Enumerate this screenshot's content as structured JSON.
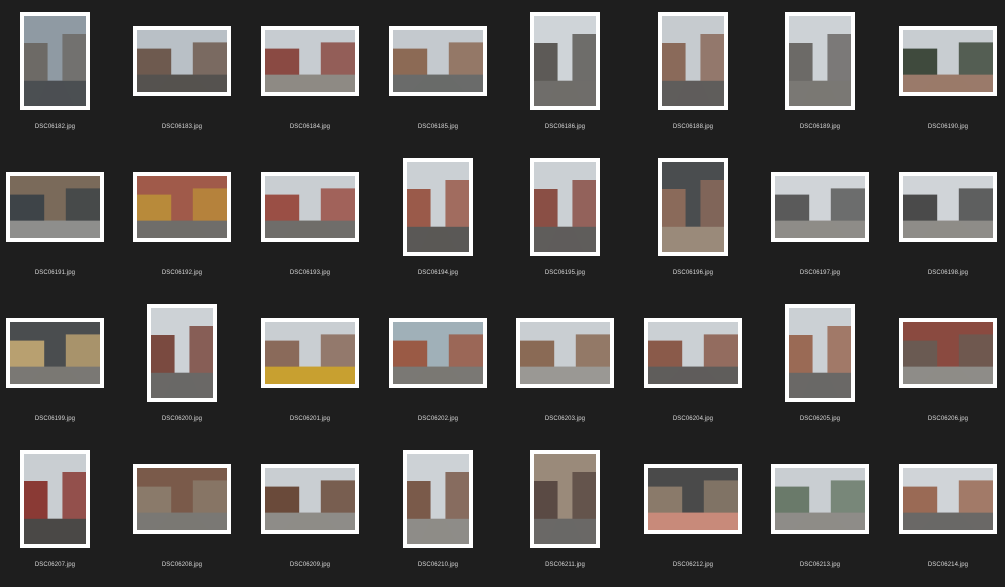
{
  "files": [
    {
      "name": "DSC06182.jpg",
      "orientation": "portrait",
      "colors": [
        "#8f9aa3",
        "#6d6a66",
        "#4b4f52"
      ]
    },
    {
      "name": "DSC06183.jpg",
      "orientation": "landscape",
      "colors": [
        "#b9c0c6",
        "#6e5a4f",
        "#55524f"
      ]
    },
    {
      "name": "DSC06184.jpg",
      "orientation": "landscape",
      "colors": [
        "#c7ccd1",
        "#8a4a43",
        "#8e8a84"
      ]
    },
    {
      "name": "DSC06185.jpg",
      "orientation": "landscape",
      "colors": [
        "#c4c9ce",
        "#8c6a55",
        "#6a6b6a"
      ]
    },
    {
      "name": "DSC06186.jpg",
      "orientation": "portrait",
      "colors": [
        "#cfd4d8",
        "#5d5a57",
        "#6f6d6a"
      ]
    },
    {
      "name": "DSC06188.jpg",
      "orientation": "portrait",
      "colors": [
        "#c6cbcf",
        "#8a6a5a",
        "#5f5d5b"
      ]
    },
    {
      "name": "DSC06189.jpg",
      "orientation": "portrait",
      "colors": [
        "#cdd2d6",
        "#6c6a67",
        "#7a7874"
      ]
    },
    {
      "name": "DSC06190.jpg",
      "orientation": "landscape",
      "colors": [
        "#c8cdd1",
        "#3f4a3d",
        "#9a7a6a"
      ]
    },
    {
      "name": "DSC06191.jpg",
      "orientation": "landscape",
      "colors": [
        "#7a6a5a",
        "#3e4448",
        "#8e8e8c"
      ]
    },
    {
      "name": "DSC06192.jpg",
      "orientation": "landscape",
      "colors": [
        "#a05a4a",
        "#b88a3a",
        "#6f6d6a"
      ]
    },
    {
      "name": "DSC06193.jpg",
      "orientation": "landscape",
      "colors": [
        "#c9ced2",
        "#9a4f45",
        "#6f6d6a"
      ]
    },
    {
      "name": "DSC06194.jpg",
      "orientation": "portrait",
      "colors": [
        "#cbd0d4",
        "#9a5a4a",
        "#5a5856"
      ]
    },
    {
      "name": "DSC06195.jpg",
      "orientation": "portrait",
      "colors": [
        "#cbd0d4",
        "#8a4f45",
        "#5f5d5b"
      ]
    },
    {
      "name": "DSC06196.jpg",
      "orientation": "portrait",
      "colors": [
        "#4a4d4f",
        "#8a6a5a",
        "#9a8a7a"
      ]
    },
    {
      "name": "DSC06197.jpg",
      "orientation": "landscape",
      "colors": [
        "#d0d4d8",
        "#5a5a5a",
        "#8e8c88"
      ]
    },
    {
      "name": "DSC06198.jpg",
      "orientation": "landscape",
      "colors": [
        "#d0d4d8",
        "#4a4a4a",
        "#8e8c88"
      ]
    },
    {
      "name": "DSC06199.jpg",
      "orientation": "landscape",
      "colors": [
        "#4a4d4f",
        "#b8a070",
        "#7a7874"
      ]
    },
    {
      "name": "DSC06200.jpg",
      "orientation": "portrait",
      "colors": [
        "#cdd2d6",
        "#7a4a40",
        "#6a6866"
      ]
    },
    {
      "name": "DSC06201.jpg",
      "orientation": "landscape",
      "colors": [
        "#c9ced2",
        "#8a6a5a",
        "#c8a030"
      ]
    },
    {
      "name": "DSC06202.jpg",
      "orientation": "landscape",
      "colors": [
        "#a0b0b8",
        "#9a5a45",
        "#7a7874"
      ]
    },
    {
      "name": "DSC06203.jpg",
      "orientation": "landscape",
      "colors": [
        "#c9ced2",
        "#8a6a55",
        "#9a9894"
      ]
    },
    {
      "name": "DSC06204.jpg",
      "orientation": "landscape",
      "colors": [
        "#cbd0d4",
        "#8a5a4a",
        "#5f5d5b"
      ]
    },
    {
      "name": "DSC06205.jpg",
      "orientation": "portrait",
      "colors": [
        "#cbd0d4",
        "#9a6a55",
        "#6a6866"
      ]
    },
    {
      "name": "DSC06206.jpg",
      "orientation": "landscape",
      "colors": [
        "#8a4a40",
        "#6a5a52",
        "#8e8c88"
      ]
    },
    {
      "name": "DSC06207.jpg",
      "orientation": "portrait",
      "colors": [
        "#c9ced2",
        "#8a3a35",
        "#4a4846"
      ]
    },
    {
      "name": "DSC06208.jpg",
      "orientation": "landscape",
      "colors": [
        "#7a5a4a",
        "#8a7a6a",
        "#7a7874"
      ]
    },
    {
      "name": "DSC06209.jpg",
      "orientation": "landscape",
      "colors": [
        "#c9ced2",
        "#6a4a3a",
        "#8e8c88"
      ]
    },
    {
      "name": "DSC06210.jpg",
      "orientation": "portrait",
      "colors": [
        "#cdd2d6",
        "#7a5a4a",
        "#8e8c88"
      ]
    },
    {
      "name": "DSC06211.jpg",
      "orientation": "portrait",
      "colors": [
        "#9a8a7a",
        "#5a4a44",
        "#6a6866"
      ]
    },
    {
      "name": "DSC06212.jpg",
      "orientation": "landscape",
      "colors": [
        "#4a4a4a",
        "#8a7a6a",
        "#c88a7a"
      ]
    },
    {
      "name": "DSC06213.jpg",
      "orientation": "landscape",
      "colors": [
        "#c9ced2",
        "#6a7a6a",
        "#8e8c88"
      ]
    },
    {
      "name": "DSC06214.jpg",
      "orientation": "landscape",
      "colors": [
        "#d0d4d8",
        "#9a6a55",
        "#6a6866"
      ]
    }
  ]
}
